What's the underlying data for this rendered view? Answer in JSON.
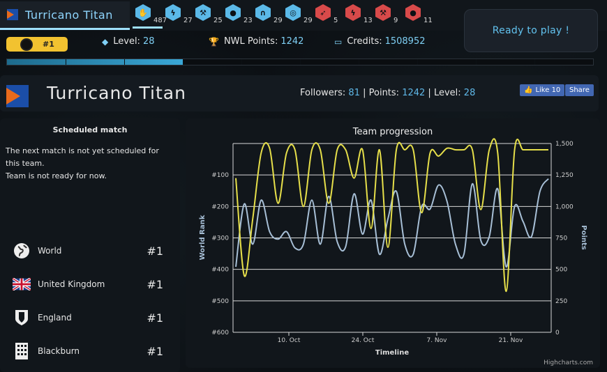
{
  "team": {
    "name": "Turricano Titan"
  },
  "badges": [
    {
      "icon": "hand-icon",
      "count": "487",
      "color": "#5bb9e8",
      "active": true
    },
    {
      "icon": "lightning-icon",
      "count": "27",
      "color": "#5bb9e8"
    },
    {
      "icon": "hammer-icon",
      "count": "25",
      "color": "#5bb9e8"
    },
    {
      "icon": "bulb-icon",
      "count": "23",
      "color": "#5bb9e8"
    },
    {
      "icon": "magnet-icon",
      "count": "29",
      "color": "#5bb9e8"
    },
    {
      "icon": "target-icon",
      "count": "29",
      "color": "#5bb9e8"
    },
    {
      "icon": "rocket-icon",
      "count": "5",
      "color": "#d84a4a"
    },
    {
      "icon": "lightning-icon",
      "count": "13",
      "color": "#d84a4a"
    },
    {
      "icon": "hammer-icon",
      "count": "9",
      "color": "#d84a4a"
    },
    {
      "icon": "bulb-icon",
      "count": "11",
      "color": "#d84a4a"
    }
  ],
  "ready_button": "Ready to play !",
  "stats": {
    "rank": "#1",
    "level_label": "Level:",
    "level_value": "28",
    "nwl_label": "NWL Points:",
    "nwl_value": "1242",
    "credits_label": "Credits:",
    "credits_value": "1508952"
  },
  "progress": 0.3,
  "header": {
    "name": "Turricano Titan",
    "followers_label": "Followers:",
    "followers": "81",
    "points_label": "Points:",
    "points": "1242",
    "level_label": "Level:",
    "level": "28",
    "fb_like": "Like 10",
    "fb_share": "Share"
  },
  "match": {
    "title": "Scheduled match",
    "line1": "The next match is not yet scheduled for this team.",
    "line2": "Team is not ready for now."
  },
  "regions": [
    {
      "name": "World",
      "rank": "#1",
      "icon": "globe-icon"
    },
    {
      "name": "United Kingdom",
      "rank": "#1",
      "icon": "uk-flag-icon"
    },
    {
      "name": "England",
      "rank": "#1",
      "icon": "shield-icon"
    },
    {
      "name": "Blackburn",
      "rank": "#1",
      "icon": "building-icon"
    }
  ],
  "chart_data": {
    "type": "line",
    "title": "Team progression",
    "xlabel": "Timeline",
    "ylabel_left": "World Rank",
    "ylabel_right": "Points",
    "left_ticks": [
      "#100",
      "#200",
      "#300",
      "#400",
      "#500",
      "#600"
    ],
    "right_ticks": [
      "1,500",
      "1,250",
      "1,000",
      "750",
      "500",
      "250",
      "0"
    ],
    "x_ticks": [
      "10. Oct",
      "24. Oct",
      "7. Nov",
      "21. Nov"
    ],
    "credit": "Highcharts.com",
    "series": [
      {
        "name": "World Rank",
        "color": "#e6df4a",
        "axis": "left",
        "values": [
          110,
          420,
          240,
          30,
          15,
          190,
          30,
          20,
          200,
          20,
          20,
          190,
          20,
          20,
          110,
          20,
          270,
          20,
          330,
          20,
          20,
          20,
          220,
          30,
          40,
          15,
          20,
          20,
          20,
          210,
          20,
          30,
          470,
          20,
          20,
          20,
          20,
          20
        ]
      },
      {
        "name": "Points",
        "color": "#a7bfd6",
        "axis": "right",
        "values": [
          520,
          1020,
          700,
          1050,
          800,
          740,
          800,
          670,
          700,
          1050,
          700,
          1080,
          720,
          680,
          1100,
          780,
          1050,
          620,
          900,
          1120,
          700,
          620,
          1000,
          980,
          1170,
          1040,
          700,
          620,
          1180,
          730,
          760,
          1140,
          520,
          1000,
          880,
          760,
          1120,
          1220
        ]
      }
    ]
  }
}
